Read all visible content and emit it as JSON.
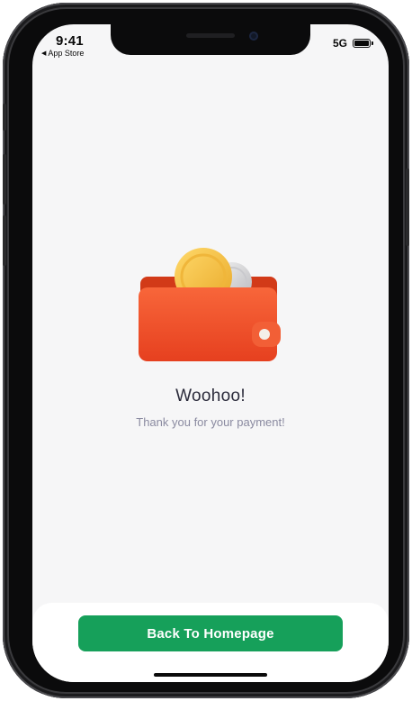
{
  "status_bar": {
    "time": "9:41",
    "back_label": "App Store",
    "network": "5G"
  },
  "content": {
    "title": "Woohoo!",
    "subtitle": "Thank you for your payment!",
    "illustration": "wallet-with-coins-icon"
  },
  "actions": {
    "back_home_label": "Back To Homepage"
  },
  "colors": {
    "accent": "#16a05a",
    "wallet": "#f1552e",
    "coin": "#f6c34a",
    "screen_bg": "#f6f6f7"
  }
}
